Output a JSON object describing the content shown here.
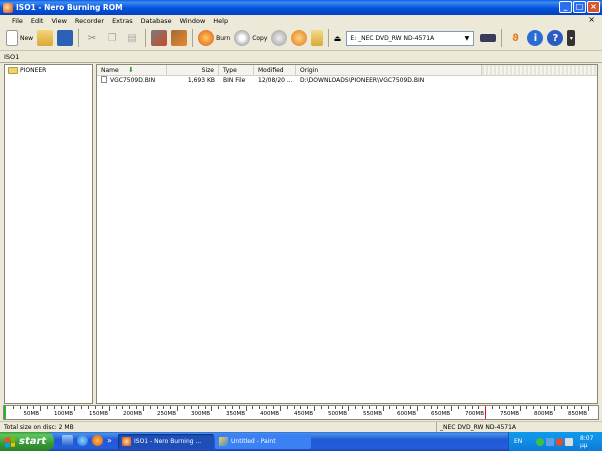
{
  "window": {
    "title": "ISO1 - Nero Burning ROM",
    "minimize": "_",
    "maximize": "□",
    "close": "×"
  },
  "menu": [
    "File",
    "Edit",
    "View",
    "Recorder",
    "Extras",
    "Database",
    "Window",
    "Help"
  ],
  "menu_close": "×",
  "toolbar": {
    "new_label": "New",
    "burn_label": "Burn",
    "copy_label": "Copy",
    "drive": "E: _NEC DVD_RW ND-4571A"
  },
  "compilation_tab": "ISO1",
  "tree": {
    "items": [
      {
        "label": "PIONEER"
      }
    ]
  },
  "file_list": {
    "headers": {
      "name": "Name",
      "size": "Size",
      "type": "Type",
      "modified": "Modified",
      "origin": "Origin"
    },
    "rows": [
      {
        "name": "VGC7509D.BIN",
        "size": "1,693 KB",
        "type": "BIN File",
        "modified": "12/08/20 ...",
        "origin": "D:\\DOWNLOADS\\PIONEER\\VGC7509D.BIN"
      }
    ]
  },
  "capacity": {
    "used_mb": 2,
    "max_mb": 850,
    "marker_mb": 700,
    "ticks": [
      "50MB",
      "100MB",
      "150MB",
      "200MB",
      "250MB",
      "300MB",
      "350MB",
      "400MB",
      "450MB",
      "500MB",
      "550MB",
      "600MB",
      "650MB",
      "700MB",
      "750MB",
      "800MB",
      "850MB"
    ]
  },
  "status": {
    "left": "Total size on disc: 2 MB",
    "right": "_NEC  DVD_RW ND-4571A"
  },
  "taskbar": {
    "start": "start",
    "tasks": [
      {
        "label": "ISO1 - Nero Burning ..."
      },
      {
        "label": "Untitled - Paint"
      }
    ],
    "chevron": "»",
    "lang": "EN",
    "clock": "8:07 μμ"
  }
}
